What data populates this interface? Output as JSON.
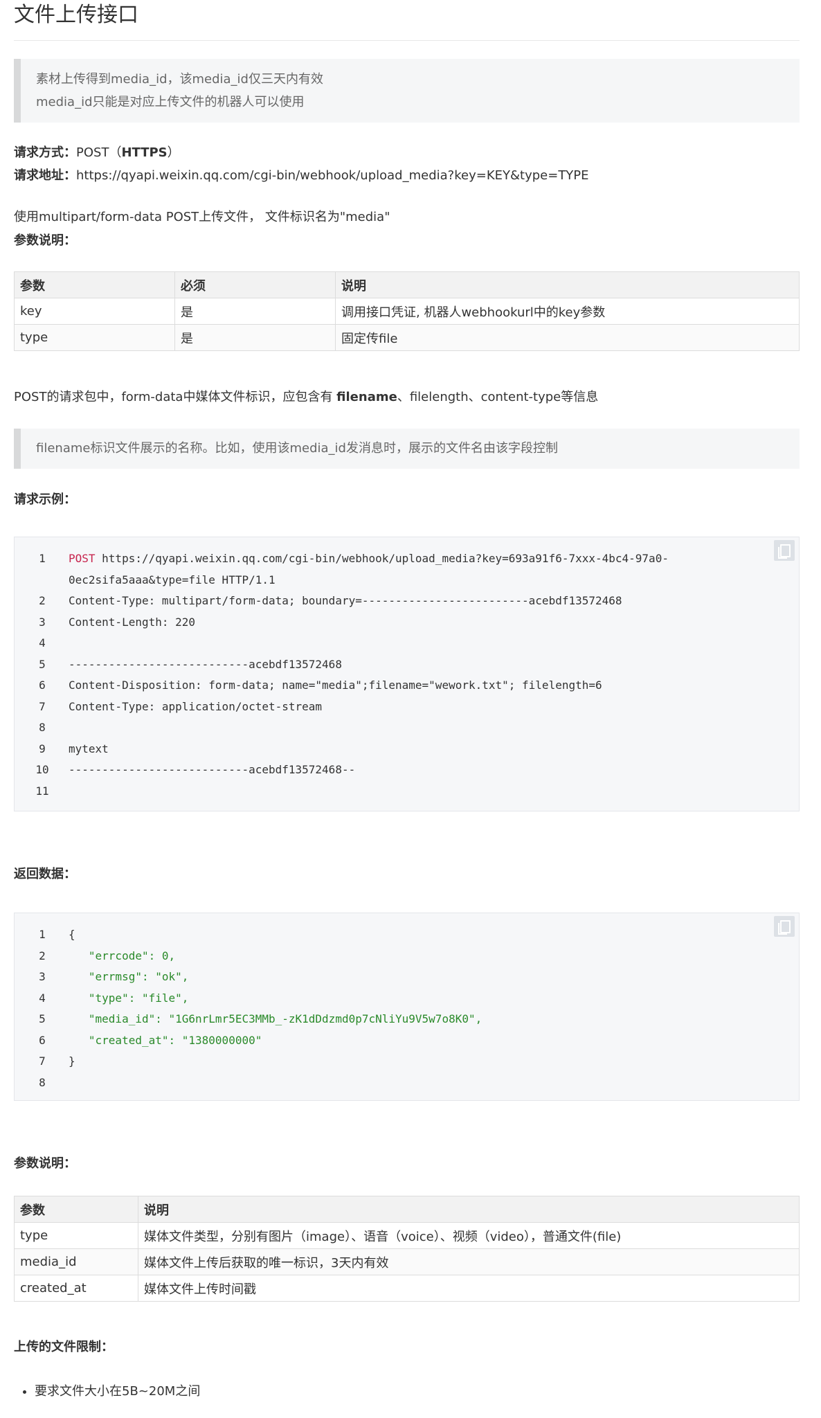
{
  "title": "文件上传接口",
  "note1": [
    "素材上传得到media_id，该media_id仅三天内有效",
    "media_id只能是对应上传文件的机器人可以使用"
  ],
  "request_method_label": "请求方式：",
  "request_method_value": "POST（",
  "request_method_bold": "HTTPS",
  "request_method_end": "）",
  "request_url_label": "请求地址：",
  "request_url_value": "https://qyapi.weixin.qq.com/cgi-bin/webhook/upload_media?key=KEY&type=TYPE",
  "multipart_note": "使用multipart/form-data POST上传文件， 文件标识名为\"media\"",
  "params_label": "参数说明：",
  "params_table": {
    "headers": [
      "参数",
      "必须",
      "说明"
    ],
    "rows": [
      [
        "key",
        "是",
        "调用接口凭证, 机器人webhookurl中的key参数"
      ],
      [
        "type",
        "是",
        "固定传file"
      ]
    ]
  },
  "post_note_prefix": "POST的请求包中，form-data中媒体文件标识，应包含有 ",
  "post_note_bold": "filename",
  "post_note_suffix": "、filelength、content-type等信息",
  "note2": "filename标识文件展示的名称。比如，使用该media_id发消息时，展示的文件名由该字段控制",
  "request_example_label": "请求示例：",
  "request_code": [
    {
      "n": "1",
      "line1": "POST https://qyapi.weixin.qq.com/cgi-bin/webhook/upload_media?key=693a91f6-7xxx-4bc4-97a0-",
      "line2": "0ec2sifa5aaa&type=file HTTP/1.1"
    },
    {
      "n": "2",
      "text": "Content-Type: multipart/form-data; boundary=-------------------------acebdf13572468"
    },
    {
      "n": "3",
      "text": "Content-Length: 220"
    },
    {
      "n": "4",
      "text": ""
    },
    {
      "n": "5",
      "text": "---------------------------acebdf13572468"
    },
    {
      "n": "6",
      "text": "Content-Disposition: form-data; name=\"media\";filename=\"wework.txt\"; filelength=6"
    },
    {
      "n": "7",
      "text": "Content-Type: application/octet-stream"
    },
    {
      "n": "8",
      "text": ""
    },
    {
      "n": "9",
      "text": "mytext"
    },
    {
      "n": "10",
      "text": "---------------------------acebdf13572468--"
    },
    {
      "n": "11",
      "text": ""
    }
  ],
  "return_label": "返回数据：",
  "response_code": [
    {
      "n": "1",
      "text": "{"
    },
    {
      "n": "2",
      "text": "   \"errcode\": 0,"
    },
    {
      "n": "3",
      "text": "   \"errmsg\": \"ok\","
    },
    {
      "n": "4",
      "text": "   \"type\": \"file\","
    },
    {
      "n": "5",
      "text": "   \"media_id\": \"1G6nrLmr5EC3MMb_-zK1dDdzmd0p7cNliYu9V5w7o8K0\","
    },
    {
      "n": "6",
      "text": "   \"created_at\": \"1380000000\""
    },
    {
      "n": "7",
      "text": "}"
    },
    {
      "n": "8",
      "text": ""
    }
  ],
  "params_label2": "参数说明：",
  "return_table": {
    "headers": [
      "参数",
      "说明"
    ],
    "rows": [
      [
        "type",
        "媒体文件类型，分别有图片（image）、语音（voice）、视频（video），普通文件(file)"
      ],
      [
        "media_id",
        "媒体文件上传后获取的唯一标识，3天内有效"
      ],
      [
        "created_at",
        "媒体文件上传时间戳"
      ]
    ]
  },
  "limits_label": "上传的文件限制：",
  "limits": [
    "要求文件大小在5B~20M之间"
  ]
}
